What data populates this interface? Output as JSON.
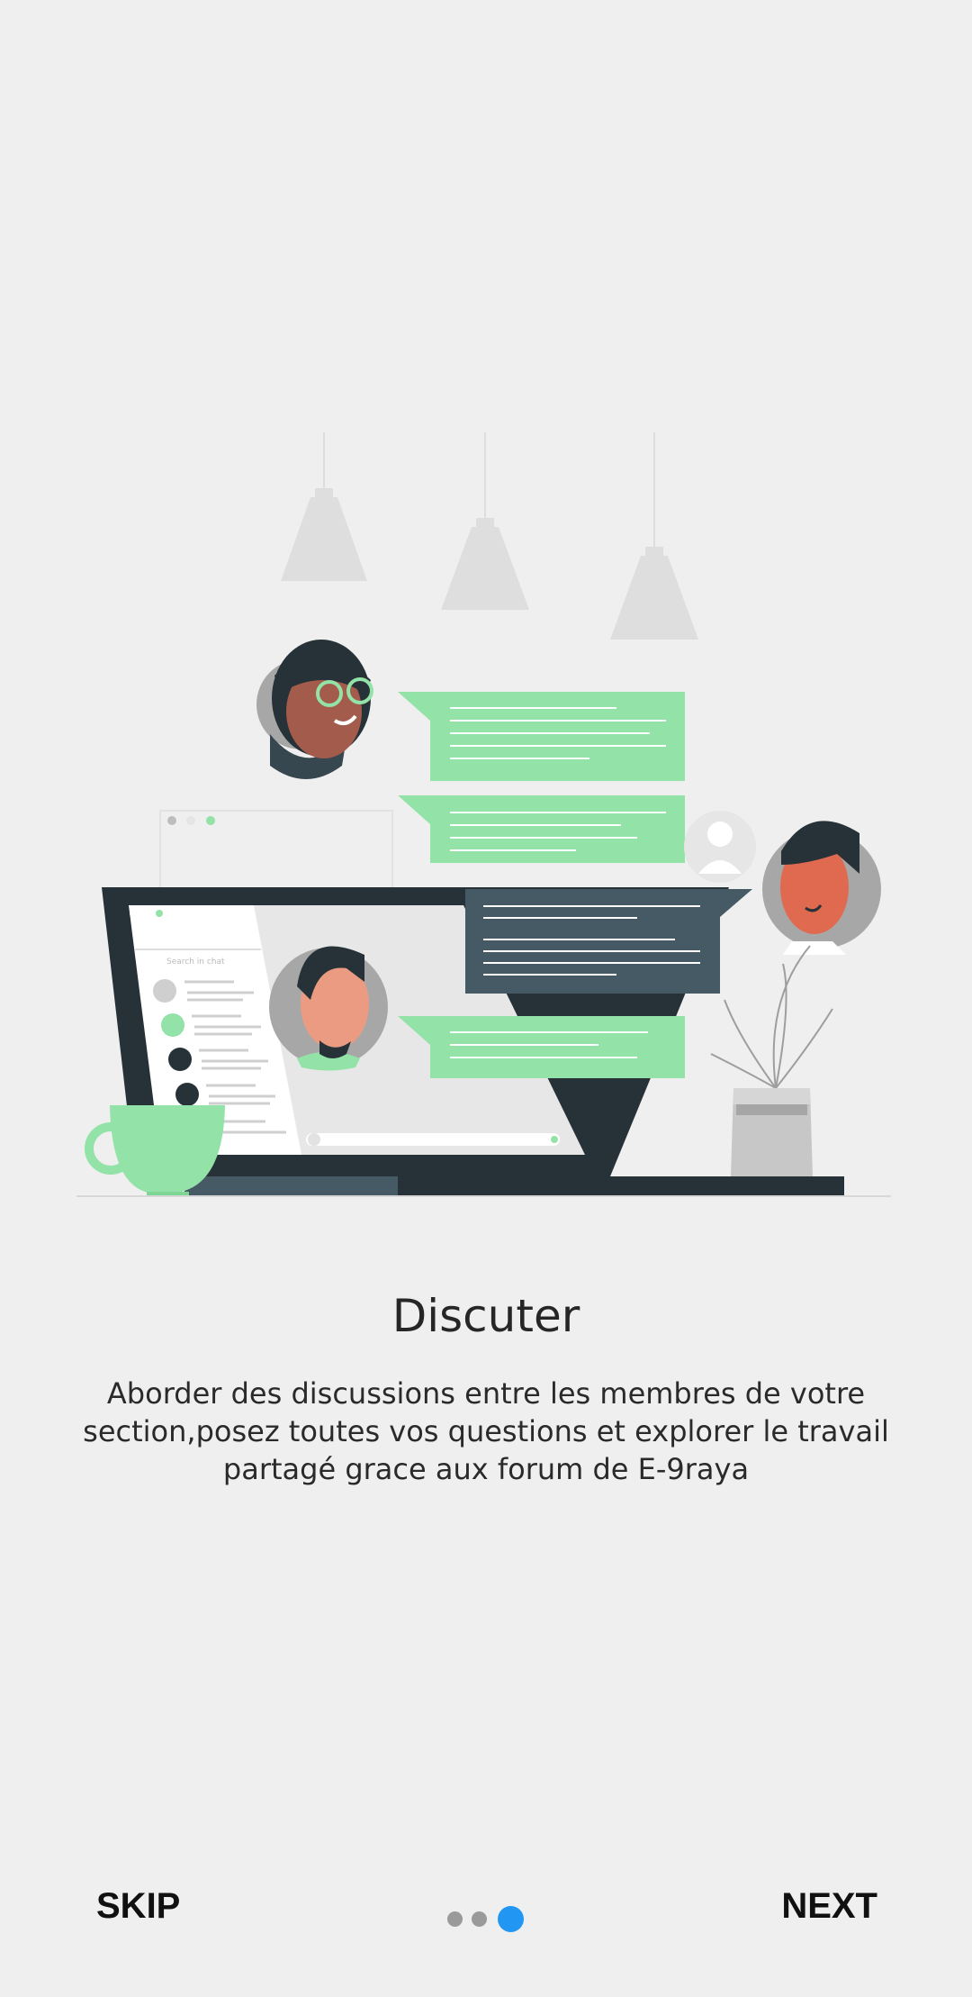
{
  "onboarding": {
    "title": "Discuter",
    "description": "Aborder des discussions entre les membres de votre section,posez toutes vos questions et explorer le travail partagé grace aux forum de E-9raya"
  },
  "navigation": {
    "skip_label": "SKIP",
    "next_label": "NEXT",
    "page_indicator": {
      "total": 3,
      "current": 3
    }
  },
  "illustration": {
    "laptop_search_placeholder": "Search in chat",
    "colors": {
      "bubble_green": "#93e2a7",
      "bubble_dark": "#455a64",
      "laptop_dark": "#263238",
      "active_dot": "#2196f3",
      "inactive_dot": "#9a9a9a"
    }
  }
}
